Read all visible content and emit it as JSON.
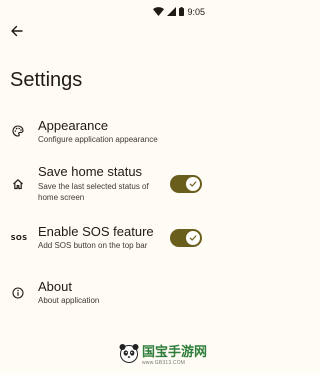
{
  "status_bar": {
    "time": "9:05"
  },
  "page_title": "Settings",
  "settings": [
    {
      "title": "Appearance",
      "description": "Configure application appearance",
      "icon": "palette-icon"
    },
    {
      "title": "Save home status",
      "description": "Save the last selected status of home screen",
      "icon": "home-icon",
      "toggle_on": true
    },
    {
      "title": "Enable SOS feature",
      "description": "Add SOS button on the top bar",
      "icon": "sos-icon",
      "icon_text": "SOS",
      "toggle_on": true
    },
    {
      "title": "About",
      "description": "About application",
      "icon": "info-icon"
    }
  ],
  "watermark": {
    "text": "国宝手游网",
    "url": "www.GB313.COM"
  },
  "colors": {
    "background": "#fffbf5",
    "toggle_track": "#6a5e1c",
    "toggle_knob": "#ffffff",
    "text_primary": "#1e1b16",
    "text_secondary": "#3d3a33"
  }
}
